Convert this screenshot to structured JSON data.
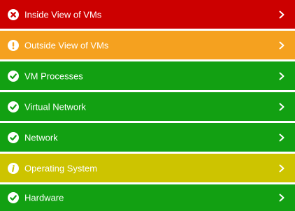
{
  "status_list": {
    "items": [
      {
        "label": "Inside View of VMs",
        "status": "error",
        "color": "#cc0000",
        "icon": "x-circle-icon"
      },
      {
        "label": "Outside View of VMs",
        "status": "warning",
        "color": "#f5a11f",
        "icon": "exclamation-circle-icon"
      },
      {
        "label": "VM Processes",
        "status": "ok",
        "color": "#12a012",
        "icon": "check-circle-icon"
      },
      {
        "label": "Virtual Network",
        "status": "ok",
        "color": "#12a012",
        "icon": "check-circle-icon"
      },
      {
        "label": "Network",
        "status": "ok",
        "color": "#12a012",
        "icon": "check-circle-icon"
      },
      {
        "label": "Operating System",
        "status": "info",
        "color": "#cdc400",
        "icon": "info-circle-icon"
      },
      {
        "label": "Hardware",
        "status": "ok",
        "color": "#12a012",
        "icon": "check-circle-icon"
      }
    ]
  }
}
